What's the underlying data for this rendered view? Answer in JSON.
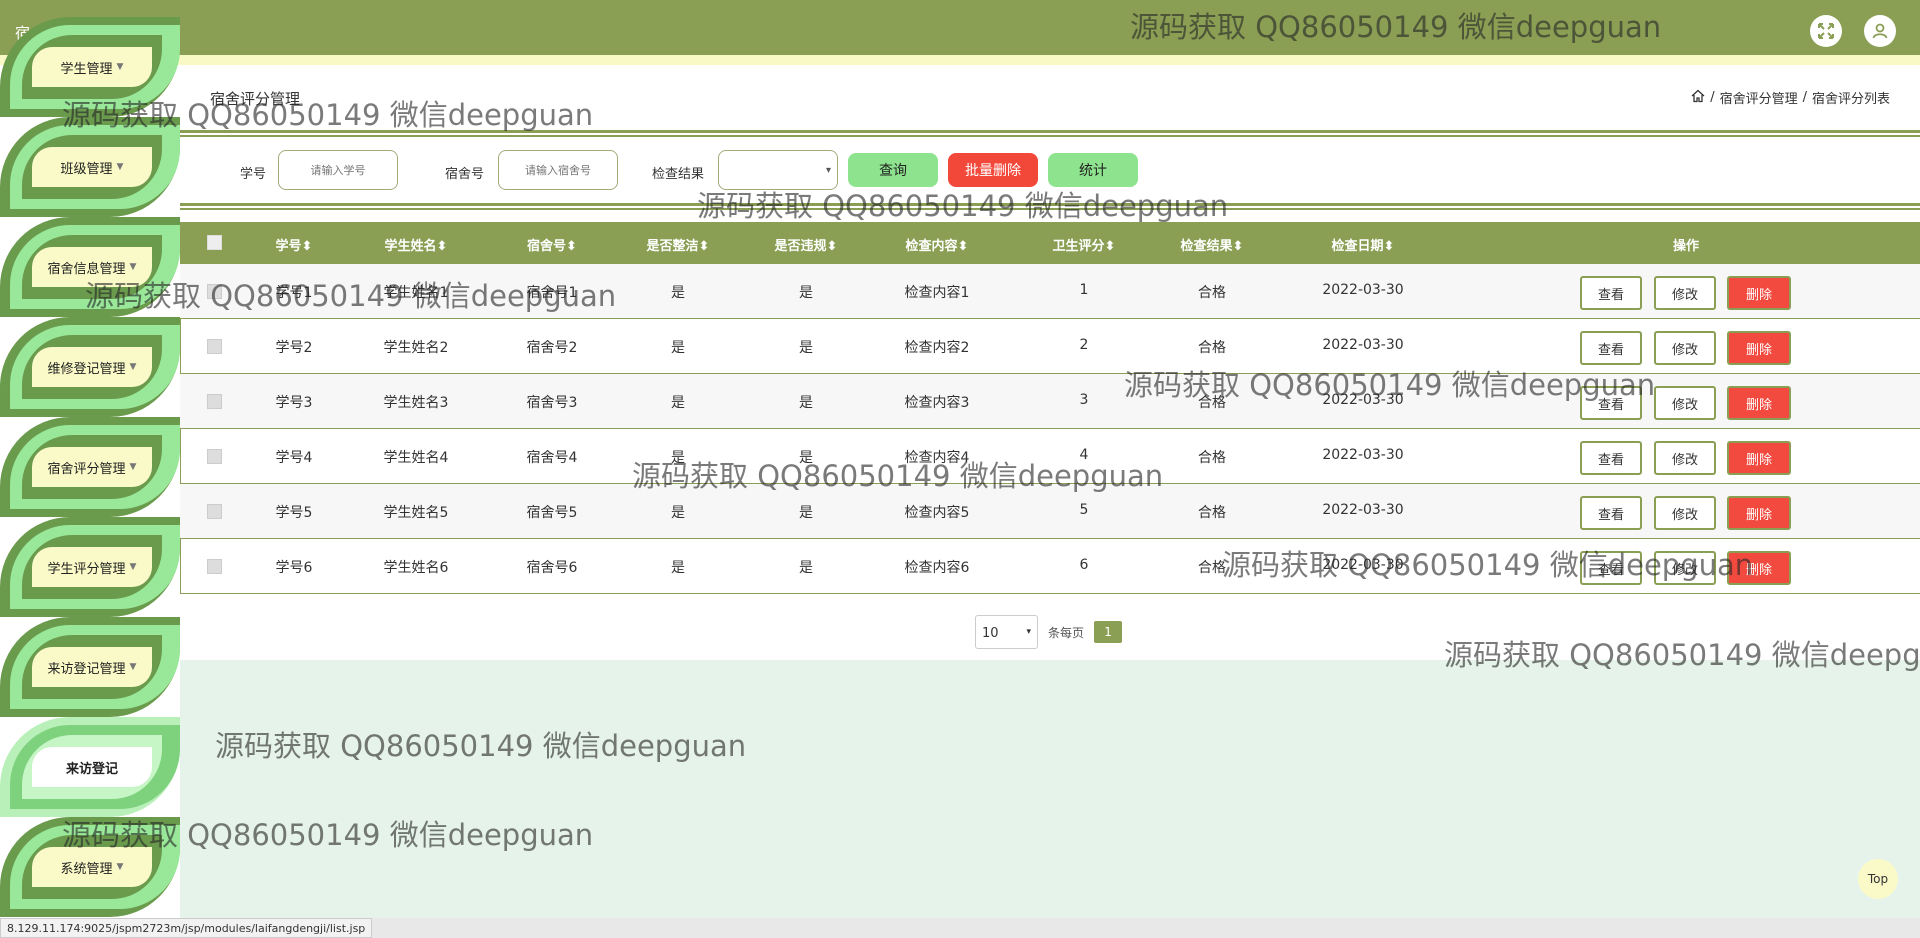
{
  "app": {
    "title": "宿舍管理系统"
  },
  "sidebar": {
    "items": [
      {
        "label": "学生管理"
      },
      {
        "label": "班级管理"
      },
      {
        "label": "宿舍信息管理"
      },
      {
        "label": "维修登记管理"
      },
      {
        "label": "宿舍评分管理"
      },
      {
        "label": "学生评分管理"
      },
      {
        "label": "来访登记管理"
      },
      {
        "label": "来访登记"
      },
      {
        "label": "系统管理"
      }
    ]
  },
  "page": {
    "title": "宿舍评分管理",
    "breadcrumb": [
      "宿舍评分管理",
      "宿舍评分列表"
    ],
    "breadcrumb_sep": "/"
  },
  "search": {
    "student_no_label": "学号",
    "student_no_placeholder": "请输入学号",
    "dorm_no_label": "宿舍号",
    "dorm_no_placeholder": "请输入宿舍号",
    "result_label": "检查结果",
    "result_value": "",
    "query_button": "查询",
    "batch_delete_button": "批量删除",
    "stats_button": "统计"
  },
  "table": {
    "columns": [
      "学号",
      "学生姓名",
      "宿舍号",
      "是否整洁",
      "是否违规",
      "检查内容",
      "卫生评分",
      "检查结果",
      "检查日期",
      "操作"
    ],
    "sort_mark": "⬍",
    "rows": [
      [
        "学号1",
        "学生姓名1",
        "宿舍号1",
        "是",
        "是",
        "检查内容1",
        "1",
        "合格",
        "2022-03-30"
      ],
      [
        "学号2",
        "学生姓名2",
        "宿舍号2",
        "是",
        "是",
        "检查内容2",
        "2",
        "合格",
        "2022-03-30"
      ],
      [
        "学号3",
        "学生姓名3",
        "宿舍号3",
        "是",
        "是",
        "检查内容3",
        "3",
        "合格",
        "2022-03-30"
      ],
      [
        "学号4",
        "学生姓名4",
        "宿舍号4",
        "是",
        "是",
        "检查内容4",
        "4",
        "合格",
        "2022-03-30"
      ],
      [
        "学号5",
        "学生姓名5",
        "宿舍号5",
        "是",
        "是",
        "检查内容5",
        "5",
        "合格",
        "2022-03-30"
      ],
      [
        "学号6",
        "学生姓名6",
        "宿舍号6",
        "是",
        "是",
        "检查内容6",
        "6",
        "合格",
        "2022-03-30"
      ]
    ],
    "actions": {
      "view": "查看",
      "edit": "修改",
      "delete": "删除"
    }
  },
  "pagination": {
    "page_size": "10",
    "per_page_label": "条每页",
    "current_page": "1"
  },
  "top_button": "Top",
  "status_url": "8.129.11.174:9025/jspm2723m/jsp/modules/laifangdengji/list.jsp",
  "watermark": "源码获取 QQ86050149 微信deepguan",
  "colors": {
    "primary": "#8a9f54",
    "leaf_dark": "#6a9a4c",
    "leaf_light": "#99e89a",
    "pill": "#fafac8",
    "danger": "#f2483a",
    "button_green": "#8ee38e",
    "lower_bg": "#e6f3ea"
  },
  "icons": {
    "fullscreen": "fullscreen-icon",
    "user": "user-icon",
    "home": "home-icon"
  }
}
